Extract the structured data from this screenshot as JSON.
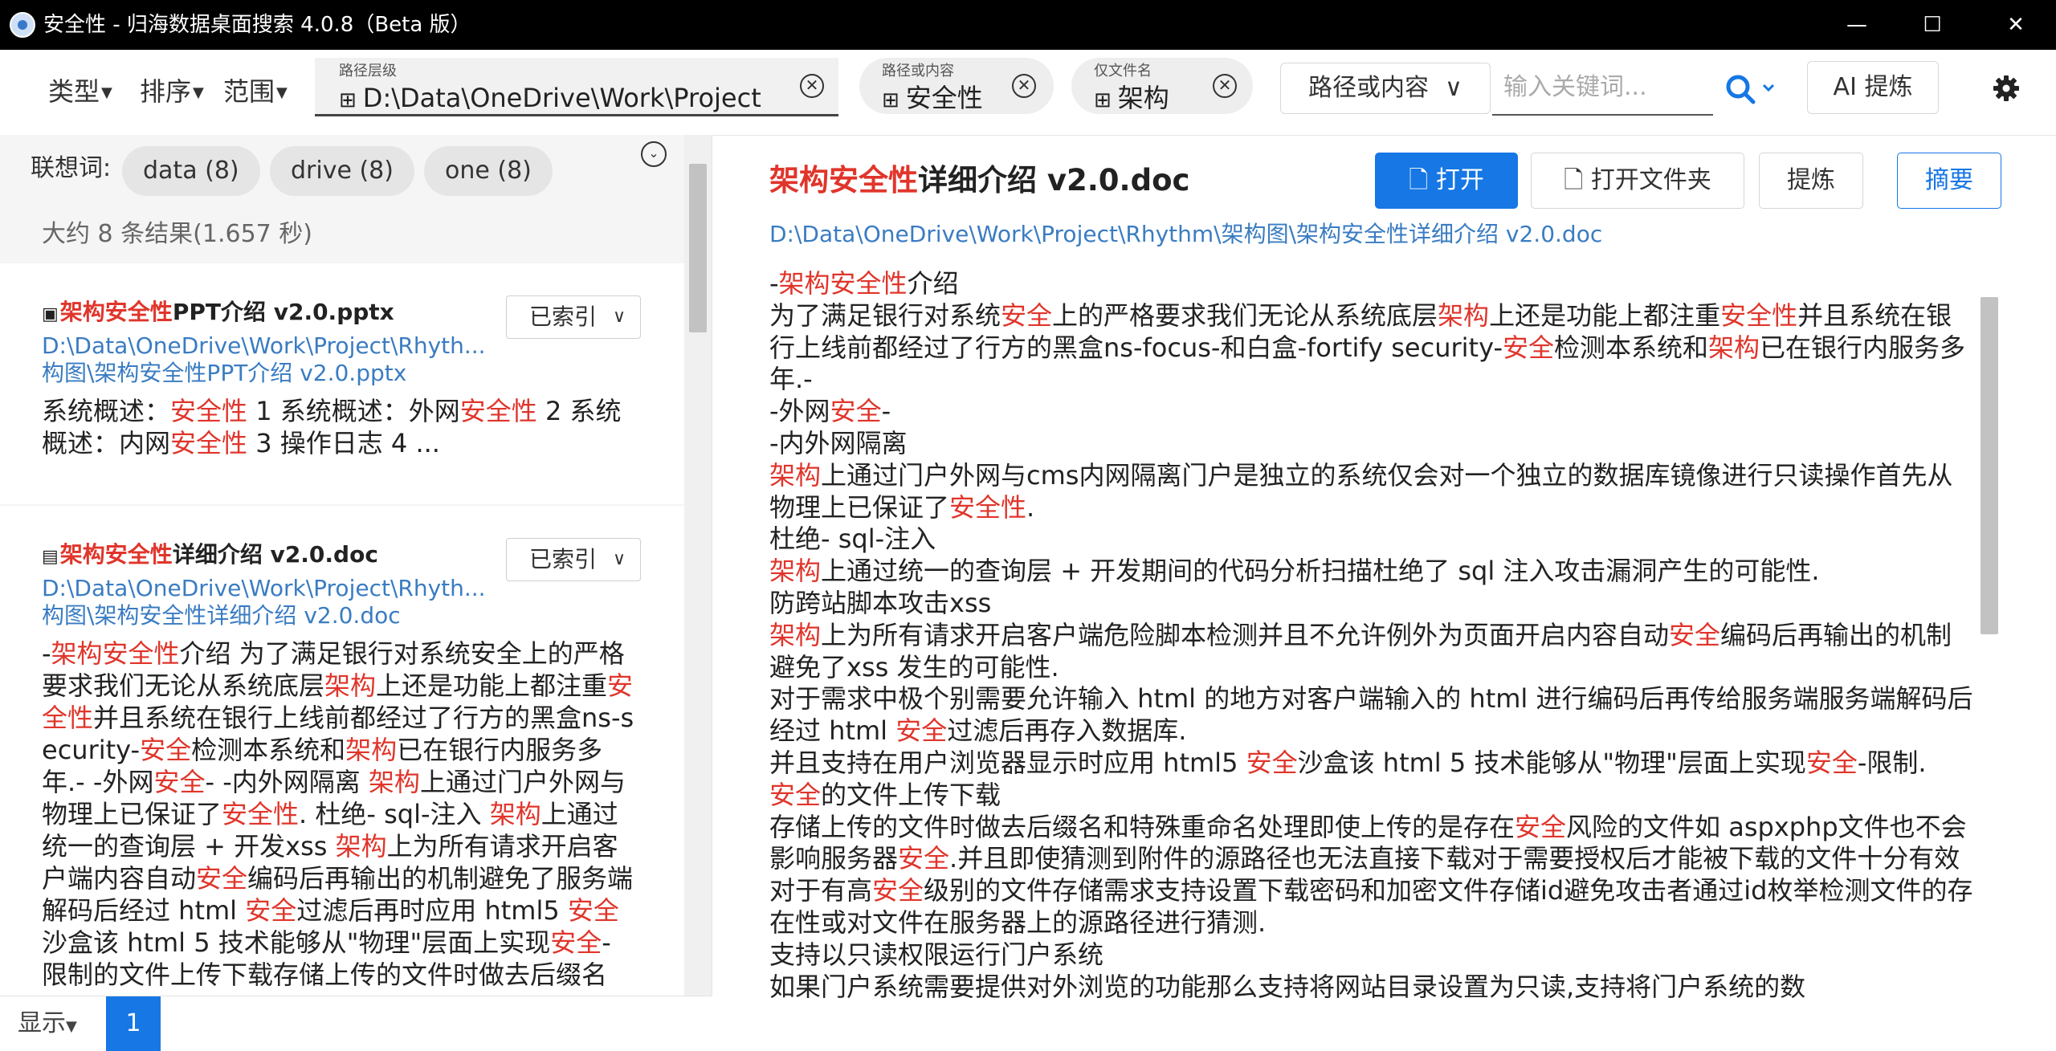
{
  "window": {
    "title": "安全性 - 归海数据桌面搜索 4.0.8（Beta 版）",
    "minimize": "—",
    "maximize": "☐",
    "close": "✕"
  },
  "toolbar": {
    "menus": [
      "类型",
      "排序",
      "范围"
    ],
    "chips": [
      {
        "label": "路径层级",
        "value": "D:\\Data\\OneDrive\\Work\\Project"
      },
      {
        "label": "路径或内容",
        "value": "安全性"
      },
      {
        "label": "仅文件名",
        "value": "架构"
      }
    ],
    "scope_select": "路径或内容",
    "search_placeholder": "输入关键词...",
    "ai_button": "AI 提炼"
  },
  "left": {
    "suggest_label": "联想词:",
    "suggestions": [
      "data (8)",
      "drive (8)",
      "one (8)"
    ],
    "result_count": "大约 8 条结果(1.657 秒)",
    "results": [
      {
        "title_hl": "架构安全性",
        "title_rest": "PPT介绍 v2.0.pptx",
        "index_status": "已索引",
        "path_line1": "D:\\Data\\OneDrive\\Work\\Project\\Rhyth...",
        "path_line2": "构图\\架构安全性PPT介绍 v2.0.pptx",
        "snippet_html": "系统概述：<span class=\"hl\">安全性</span> 1 系统概述：外网<span class=\"hl\">安全性</span> 2 系统概述：内网<span class=\"hl\">安全性</span> 3 操作日志 4 ..."
      },
      {
        "title_hl": "架构安全性",
        "title_rest": "详细介绍 v2.0.doc",
        "index_status": "已索引",
        "path_line1": "D:\\Data\\OneDrive\\Work\\Project\\Rhyth...",
        "path_line2": "构图\\架构安全性详细介绍 v2.0.doc",
        "snippet_html": "-<span class=\"hl\">架构安全性</span>介绍 为了满足银行对系统安全上的严格要求我们无论从系统底层<span class=\"hl\">架构</span>上还是功能上都注重<span class=\"hl\">安全性</span>并且系统在银行上线前都经过了行方的黑盒ns-security-<span class=\"hl\">安全</span>检测本系统和<span class=\"hl\">架构</span>已在银行内服务多年.- -外网<span class=\"hl\">安全</span>- -内外网隔离 <span class=\"hl\">架构</span>上通过门户外网与物理上已保证了<span class=\"hl\">安全性</span>. 杜绝- sql-注入 <span class=\"hl\">架构</span>上通过统一的查询层 + 开发xss <span class=\"hl\">架构</span>上为所有请求开启客户端内容自动<span class=\"hl\">安全</span>编码后再输出的机制避免了服务端解码后经过 html <span class=\"hl\">安全</span>过滤后再时应用 html5 <span class=\"hl\">安全</span>沙盒该 html 5 技术能够从\"物理\"层面上实现<span class=\"hl\">安全</span>-限制的文件上传下载存储上传的文件时做去后缀名"
      }
    ]
  },
  "doc": {
    "title_hl": "架构安全性",
    "title_rest": "详细介绍 v2.0.doc",
    "path": "D:\\Data\\OneDrive\\Work\\Project\\Rhythm\\架构图\\架构安全性详细介绍 v2.0.doc",
    "buttons": {
      "open": "打开",
      "open_folder": "打开文件夹",
      "refine": "提炼",
      "summary": "摘要"
    },
    "body_html": [
      "-<span class=\"hl\">架构安全性</span>介绍",
      "为了满足银行对系统<span class=\"hl\">安全</span>上的严格要求我们无论从系统底层<span class=\"hl\">架构</span>上还是功能上都注重<span class=\"hl\">安全性</span>并且系统在银行上线前都经过了行方的黑盒ns-focus-和白盒-fortify security-<span class=\"hl\">安全</span>检测本系统和<span class=\"hl\">架构</span>已在银行内服务多年.-",
      "-外网<span class=\"hl\">安全</span>-",
      "-内外网隔离",
      "<span class=\"hl\">架构</span>上通过门户外网与cms内网隔离门户是独立的系统仅会对一个独立的数据库镜像进行只读操作首先从物理上已保证了<span class=\"hl\">安全性</span>.",
      "杜绝- sql-注入",
      "<span class=\"hl\">架构</span>上通过统一的查询层 + 开发期间的代码分析扫描杜绝了 sql 注入攻击漏洞产生的可能性.",
      "防跨站脚本攻击xss",
      "<span class=\"hl\">架构</span>上为所有请求开启客户端危险脚本检测并且不允许例外为页面开启内容自动<span class=\"hl\">安全</span>编码后再输出的机制避免了xss 发生的可能性.",
      "对于需求中极个别需要允许输入 html 的地方对客户端输入的 html 进行编码后再传给服务端服务端解码后经过 html <span class=\"hl\">安全</span>过滤后再存入数据库.",
      "并且支持在用户浏览器显示时应用 html5 <span class=\"hl\">安全</span>沙盒该 html 5 技术能够从\"物理\"层面上实现<span class=\"hl\">安全</span>-限制.",
      "<span class=\"hl\">安全</span>的文件上传下载",
      "存储上传的文件时做去后缀名和特殊重命名处理即使上传的是存在<span class=\"hl\">安全</span>风险的文件如 aspxphp文件也不会影响服务器<span class=\"hl\">安全</span>.并且即使猜测到附件的源路径也无法直接下载对于需要授权后才能被下载的文件十分有效",
      "对于有高<span class=\"hl\">安全</span>级别的文件存储需求支持设置下载密码和加密文件存储id避免攻击者通过id枚举检测文件的存在性或对文件在服务器上的源路径进行猜测.",
      "支持以只读权限运行门户系统",
      "如果门户系统需要提供对外浏览的功能那么支持将网站目录设置为只读,支持将门户系统的数"
    ]
  },
  "footer": {
    "show_label": "显示",
    "page": "1"
  },
  "colors": {
    "accent": "#1677e5",
    "highlight": "#e0352b",
    "path": "#3a7cc2"
  }
}
